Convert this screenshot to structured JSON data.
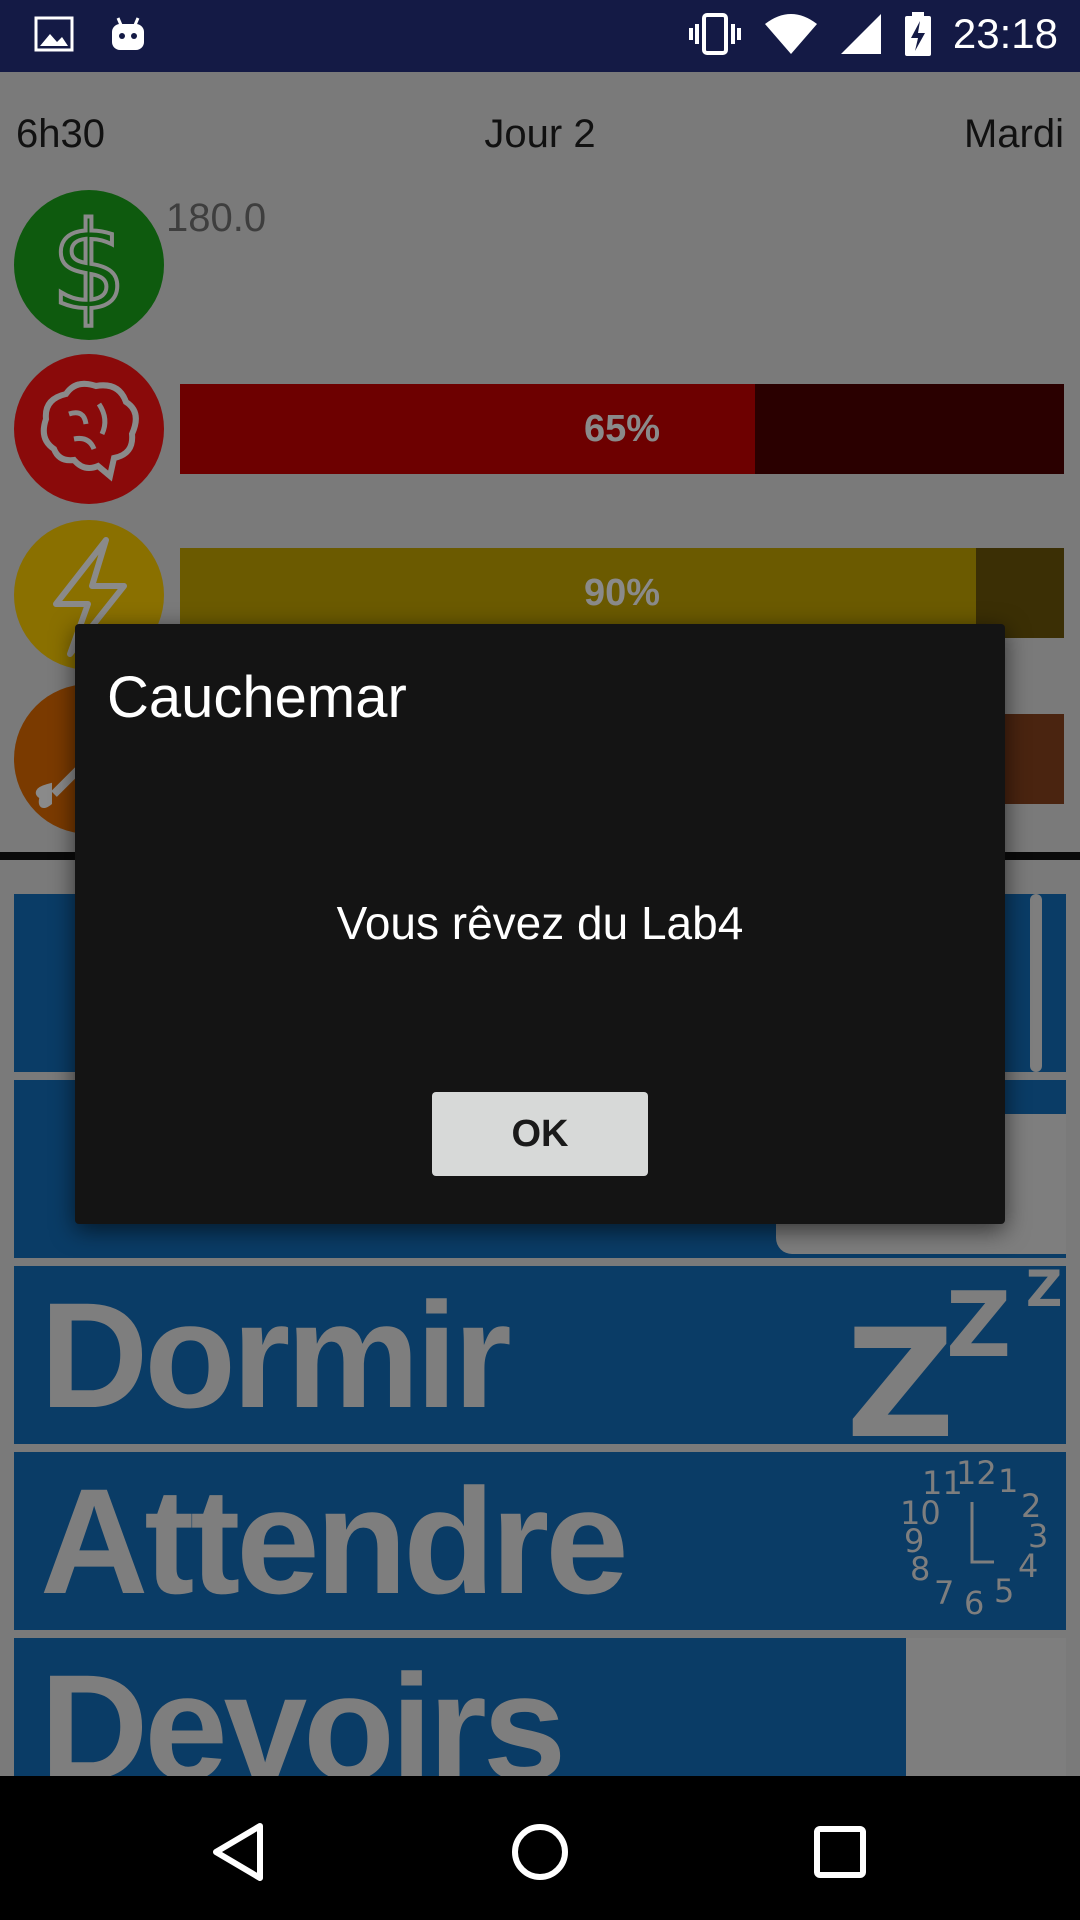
{
  "status_bar": {
    "time": "23:18"
  },
  "header": {
    "time": "6h30",
    "day": "Jour 2",
    "weekday": "Mardi"
  },
  "stats": {
    "money_value": "180.0",
    "brain": {
      "percent_label": "65%",
      "level": 0.65,
      "fill": "#6d0000",
      "track": "#2a0000",
      "icon_bg": "#b00000"
    },
    "energy": {
      "percent_label": "90%",
      "level": 0.9,
      "fill": "#6b5a00",
      "track": "#3b2f05",
      "icon_bg": "#c9a200"
    },
    "food": {
      "fill": "#5a2a08",
      "track": "#4a2410",
      "icon_bg": "#b05500"
    }
  },
  "actions": {
    "dormir": "Dormir",
    "attendre": "Attendre",
    "devoirs": "Devoirs"
  },
  "dialog": {
    "title": "Cauchemar",
    "message": "Vous rêvez du Lab4",
    "ok_label": "OK"
  },
  "colors": {
    "status_bar": "#141a45",
    "overlay_bg": "#7a7a7a",
    "action_bg": "#0a3c66",
    "dialog_bg": "#141414"
  }
}
